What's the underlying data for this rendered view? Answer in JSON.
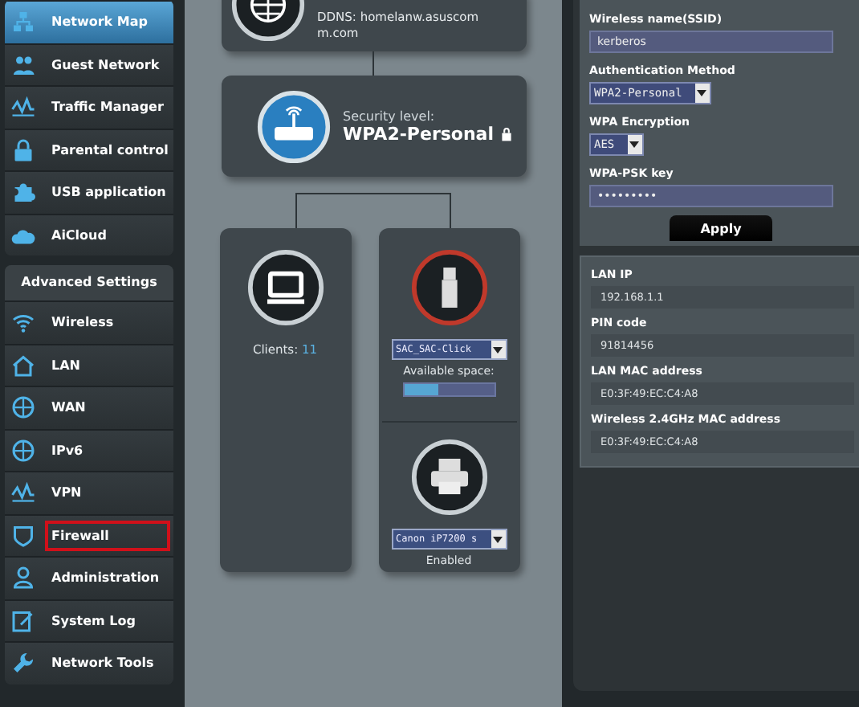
{
  "sidebar": {
    "items": [
      {
        "label": "Network Map",
        "selected": true,
        "highlighted": false
      },
      {
        "label": "Guest Network",
        "selected": false,
        "highlighted": false
      },
      {
        "label": "Traffic Manager",
        "selected": false,
        "highlighted": false
      },
      {
        "label": "Parental control",
        "selected": false,
        "highlighted": false
      },
      {
        "label": "USB application",
        "selected": false,
        "highlighted": false
      },
      {
        "label": "AiCloud",
        "selected": false,
        "highlighted": false
      }
    ],
    "advanced_title": "Advanced Settings",
    "advanced_items": [
      {
        "label": "Wireless",
        "selected": false,
        "highlighted": false
      },
      {
        "label": "LAN",
        "selected": false,
        "highlighted": false
      },
      {
        "label": "WAN",
        "selected": false,
        "highlighted": false
      },
      {
        "label": "IPv6",
        "selected": false,
        "highlighted": false
      },
      {
        "label": "VPN",
        "selected": false,
        "highlighted": false
      },
      {
        "label": "Firewall",
        "selected": false,
        "highlighted": true
      },
      {
        "label": "Administration",
        "selected": false,
        "highlighted": false
      },
      {
        "label": "System Log",
        "selected": false,
        "highlighted": false
      },
      {
        "label": "Network Tools",
        "selected": false,
        "highlighted": false
      }
    ]
  },
  "network_map": {
    "internet": {
      "ddns": "DDNS: homelanw.asuscom m.com"
    },
    "router": {
      "label": "Security level:",
      "value": "WPA2-Personal"
    },
    "clients": {
      "label": "Clients:",
      "count": "11"
    },
    "usb": {
      "device": "SAC_SAC-Click",
      "label": "Available space:",
      "level": 0.38
    },
    "printer": {
      "device": "Canon iP7200 s",
      "status": "Enabled"
    }
  },
  "wireless_panel": {
    "fields": [
      {
        "kind": "text",
        "label": "Wireless name(SSID)",
        "value": "kerberos"
      },
      {
        "kind": "select",
        "label": "Authentication Method",
        "value": "WPA2-Personal"
      },
      {
        "kind": "select",
        "label": "WPA Encryption",
        "value": "AES"
      },
      {
        "kind": "password",
        "label": "WPA-PSK key",
        "value": "•••••••••"
      }
    ],
    "apply": "Apply",
    "info": [
      {
        "label": "LAN IP",
        "value": "192.168.1.1"
      },
      {
        "label": "PIN code",
        "value": "91814456"
      },
      {
        "label": "LAN MAC address",
        "value": "E0:3F:49:EC:C4:A8"
      },
      {
        "label": "Wireless 2.4GHz MAC address",
        "value": "E0:3F:49:EC:C4:A8"
      }
    ]
  }
}
